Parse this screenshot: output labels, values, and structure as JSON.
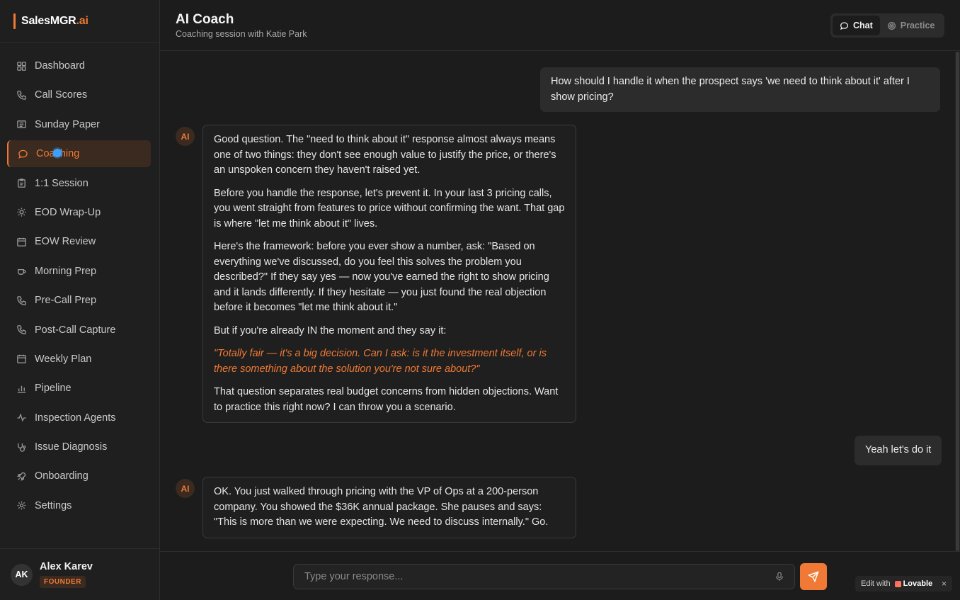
{
  "brand": {
    "name": "SalesMGR",
    "suffix": ".ai",
    "accent": "#f07a35"
  },
  "sidebar": {
    "items": [
      {
        "label": "Dashboard",
        "icon": "grid-icon"
      },
      {
        "label": "Call Scores",
        "icon": "phone-icon"
      },
      {
        "label": "Sunday Paper",
        "icon": "newspaper-icon"
      },
      {
        "label": "Coaching",
        "icon": "chat-bubble-icon",
        "active": true
      },
      {
        "label": "1:1 Session",
        "icon": "clipboard-icon"
      },
      {
        "label": "EOD Wrap-Up",
        "icon": "sun-icon"
      },
      {
        "label": "EOW Review",
        "icon": "calendar-icon"
      },
      {
        "label": "Morning Prep",
        "icon": "coffee-icon"
      },
      {
        "label": "Pre-Call Prep",
        "icon": "phone-icon"
      },
      {
        "label": "Post-Call Capture",
        "icon": "phone-icon"
      },
      {
        "label": "Weekly Plan",
        "icon": "calendar-icon"
      },
      {
        "label": "Pipeline",
        "icon": "bar-chart-icon"
      },
      {
        "label": "Inspection Agents",
        "icon": "activity-icon"
      },
      {
        "label": "Issue Diagnosis",
        "icon": "stethoscope-icon"
      },
      {
        "label": "Onboarding",
        "icon": "rocket-icon"
      },
      {
        "label": "Settings",
        "icon": "gear-icon"
      }
    ]
  },
  "user": {
    "initials": "AK",
    "name": "Alex Karev",
    "role": "FOUNDER"
  },
  "header": {
    "title": "AI Coach",
    "subtitle": "Coaching session with Katie Park",
    "modes": [
      {
        "label": "Chat",
        "active": true
      },
      {
        "label": "Practice",
        "active": false
      }
    ]
  },
  "messages": {
    "m1": "How should I handle it when the prospect says 'we need to think about it' after I show pricing?",
    "ai_badge": "AI",
    "m2": {
      "p1": "Good question. The \"need to think about it\" response almost always means one of two things: they don't see enough value to justify the price, or there's an unspoken concern they haven't raised yet.",
      "p2": "Before you handle the response, let's prevent it. In your last 3 pricing calls, you went straight from features to price without confirming the want. That gap is where \"let me think about it\" lives.",
      "p3": "Here's the framework: before you ever show a number, ask: \"Based on everything we've discussed, do you feel this solves the problem you described?\" If they say yes — now you've earned the right to show pricing and it lands differently. If they hesitate — you just found the real objection before it becomes \"let me think about it.\"",
      "p4": "But if you're already IN the moment and they say it:",
      "quote": "\"Totally fair — it's a big decision. Can I ask: is it the investment itself, or is there something about the solution you're not sure about?\"",
      "p5": "That question separates real budget concerns from hidden objections. Want to practice this right now? I can throw you a scenario."
    },
    "m3": "Yeah let's do it",
    "m4": "OK. You just walked through pricing with the VP of Ops at a 200-person company. You showed the $36K annual package. She pauses and says: \"This is more than we were expecting. We need to discuss internally.\" Go."
  },
  "composer": {
    "placeholder": "Type your response..."
  },
  "lovable": {
    "prefix": "Edit with",
    "brand": "Lovable",
    "close": "×"
  }
}
